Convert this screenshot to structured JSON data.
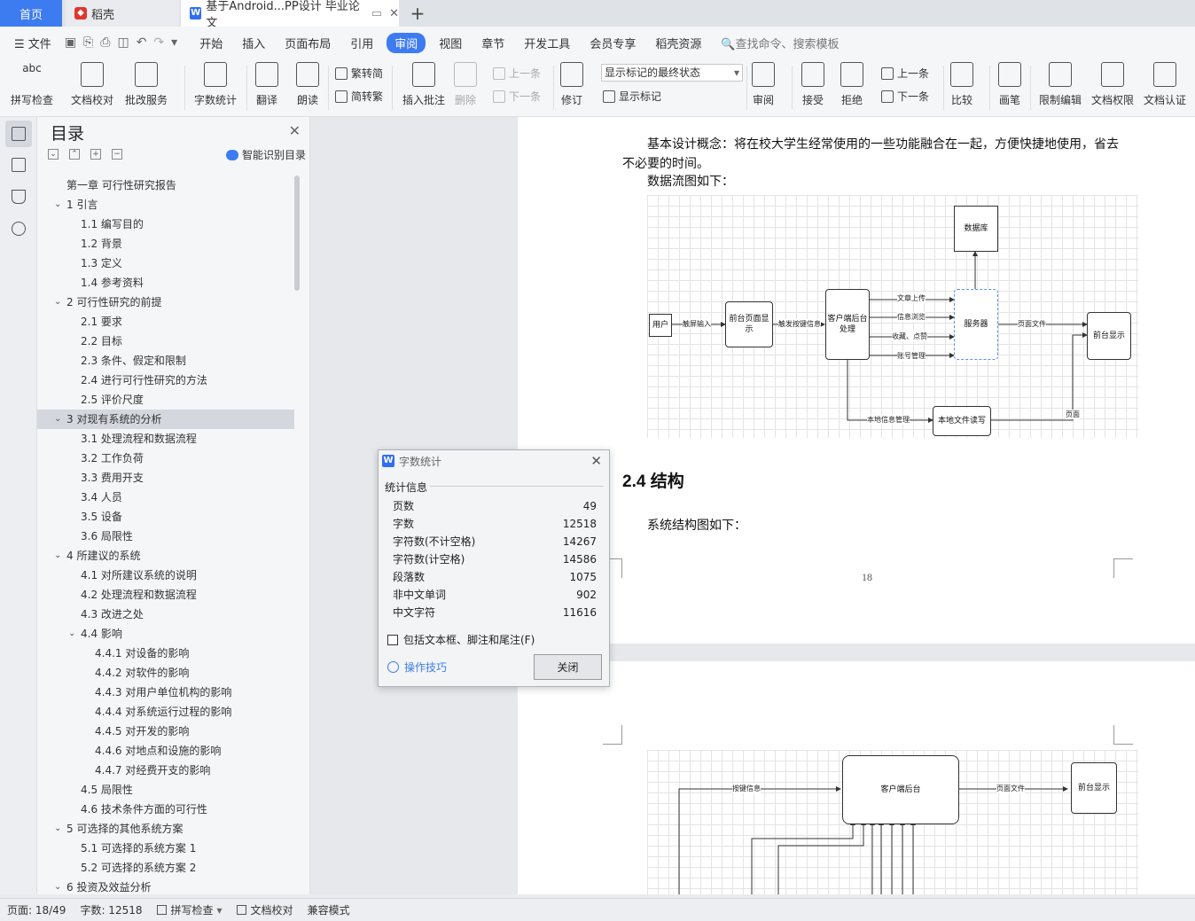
{
  "tabs": {
    "home": "首页",
    "daoke": "稻壳",
    "doc": "基于Android...PP设计 毕业论文"
  },
  "menu": {
    "file": "文件",
    "items": [
      "开始",
      "插入",
      "页面布局",
      "引用",
      "审阅",
      "视图",
      "章节",
      "开发工具",
      "会员专享",
      "稻壳资源"
    ],
    "active": "审阅",
    "search": "查找命令、搜索模板"
  },
  "ribbon": {
    "spell": "拼写检查",
    "proof": "文档校对",
    "batch": "批改服务",
    "wordcount": "字数统计",
    "translate": "翻译",
    "read": "朗读",
    "trad": "繁转简",
    "simp": "简转繁",
    "comment": "插入批注",
    "delete": "删除",
    "prev": "上一条",
    "next": "下一条",
    "revise": "修订",
    "markup_state": "显示标记的最终状态",
    "show_markup": "显示标记",
    "review": "审阅",
    "accept": "接受",
    "reject": "拒绝",
    "prev2": "上一条",
    "next2": "下一条",
    "compare": "比较",
    "pen": "画笔",
    "restrict": "限制编辑",
    "perm": "文档权限",
    "cert": "文档认证"
  },
  "toc": {
    "title": "目录",
    "smart": "智能识别目录",
    "items": [
      {
        "t": "第一章  可行性研究报告",
        "lv": 0
      },
      {
        "t": "1 引言",
        "lv": 1,
        "c": true
      },
      {
        "t": "1.1 编写目的",
        "lv": 2
      },
      {
        "t": "1.2 背景",
        "lv": 2
      },
      {
        "t": "1.3 定义",
        "lv": 2
      },
      {
        "t": "1.4 参考资料",
        "lv": 2
      },
      {
        "t": "2 可行性研究的前提",
        "lv": 1,
        "c": true
      },
      {
        "t": "2.1 要求",
        "lv": 2
      },
      {
        "t": "2.2 目标",
        "lv": 2
      },
      {
        "t": "2.3 条件、假定和限制",
        "lv": 2
      },
      {
        "t": "2.4 进行可行性研究的方法",
        "lv": 2
      },
      {
        "t": "2.5 评价尺度",
        "lv": 2
      },
      {
        "t": "3 对现有系统的分析",
        "lv": 1,
        "c": true,
        "sel": true
      },
      {
        "t": "3.1 处理流程和数据流程",
        "lv": 2
      },
      {
        "t": "3.2 工作负荷",
        "lv": 2
      },
      {
        "t": "3.3 费用开支",
        "lv": 2
      },
      {
        "t": "3.4 人员",
        "lv": 2
      },
      {
        "t": "3.5 设备",
        "lv": 2
      },
      {
        "t": "3.6 局限性",
        "lv": 2
      },
      {
        "t": "4 所建议的系统",
        "lv": 1,
        "c": true
      },
      {
        "t": "4.1 对所建议系统的说明",
        "lv": 2
      },
      {
        "t": "4.2 处理流程和数据流程",
        "lv": 2
      },
      {
        "t": "4.3 改进之处",
        "lv": 2
      },
      {
        "t": "4.4 影响",
        "lv": 2,
        "c": true
      },
      {
        "t": "4.4.1 对设备的影响",
        "lv": 3
      },
      {
        "t": "4.4.2 对软件的影响",
        "lv": 3
      },
      {
        "t": "4.4.3 对用户单位机构的影响",
        "lv": 3
      },
      {
        "t": "4.4.4 对系统运行过程的影响",
        "lv": 3
      },
      {
        "t": "4.4.5 对开发的影响",
        "lv": 3
      },
      {
        "t": "4.4.6 对地点和设施的影响",
        "lv": 3
      },
      {
        "t": "4.4.7 对经费开支的影响",
        "lv": 3
      },
      {
        "t": "4.5 局限性",
        "lv": 2
      },
      {
        "t": "4.6 技术条件方面的可行性",
        "lv": 2
      },
      {
        "t": "5 可选择的其他系统方案",
        "lv": 1,
        "c": true
      },
      {
        "t": "5.1 可选择的系统方案 1",
        "lv": 2
      },
      {
        "t": "5.2 可选择的系统方案 2",
        "lv": 2
      },
      {
        "t": "6 投资及效益分析",
        "lv": 1,
        "c": true
      }
    ]
  },
  "doc": {
    "p1a": "基本设计概念：将在校大学生经常使用的一些功能融合在一起，方便快捷地使用，省去",
    "p1b": "不必要的时间。",
    "p2": "数据流图如下：",
    "heading": "2.4 结构",
    "p3": "系统结构图如下：",
    "pagenum": "18",
    "flow": {
      "user": "用户",
      "front": "前台页面显示",
      "client": "客户端后台处理",
      "server": "服务器",
      "db": "数据库",
      "display": "前台显示",
      "local": "本地文件读写",
      "e_touch": "触屏输入",
      "e_keyinfo": "触发按键信息",
      "e_upload": "文章上传",
      "e_browse": "信息浏览",
      "e_fav": "收藏、点赞",
      "e_account": "账号管理",
      "e_page": "页面文件",
      "e_localmgr": "本地信息管理",
      "e_pg": "页面"
    },
    "flow2": {
      "client": "客户端后台",
      "display": "前台显示",
      "e_key": "按键信息",
      "e_page": "页面文件"
    }
  },
  "dialog": {
    "title": "字数统计",
    "section": "统计信息",
    "rows": [
      {
        "k": "页数",
        "v": "49"
      },
      {
        "k": "字数",
        "v": "12518"
      },
      {
        "k": "字符数(不计空格)",
        "v": "14267"
      },
      {
        "k": "字符数(计空格)",
        "v": "14586"
      },
      {
        "k": "段落数",
        "v": "1075"
      },
      {
        "k": "非中文单词",
        "v": "902"
      },
      {
        "k": "中文字符",
        "v": "11616"
      }
    ],
    "include": "包括文本框、脚注和尾注(F)",
    "tips": "操作技巧",
    "close": "关闭"
  },
  "status": {
    "page": "页面: 18/49",
    "words": "字数: 12518",
    "spell": "拼写检查",
    "proof": "文档校对",
    "compat": "兼容模式"
  }
}
